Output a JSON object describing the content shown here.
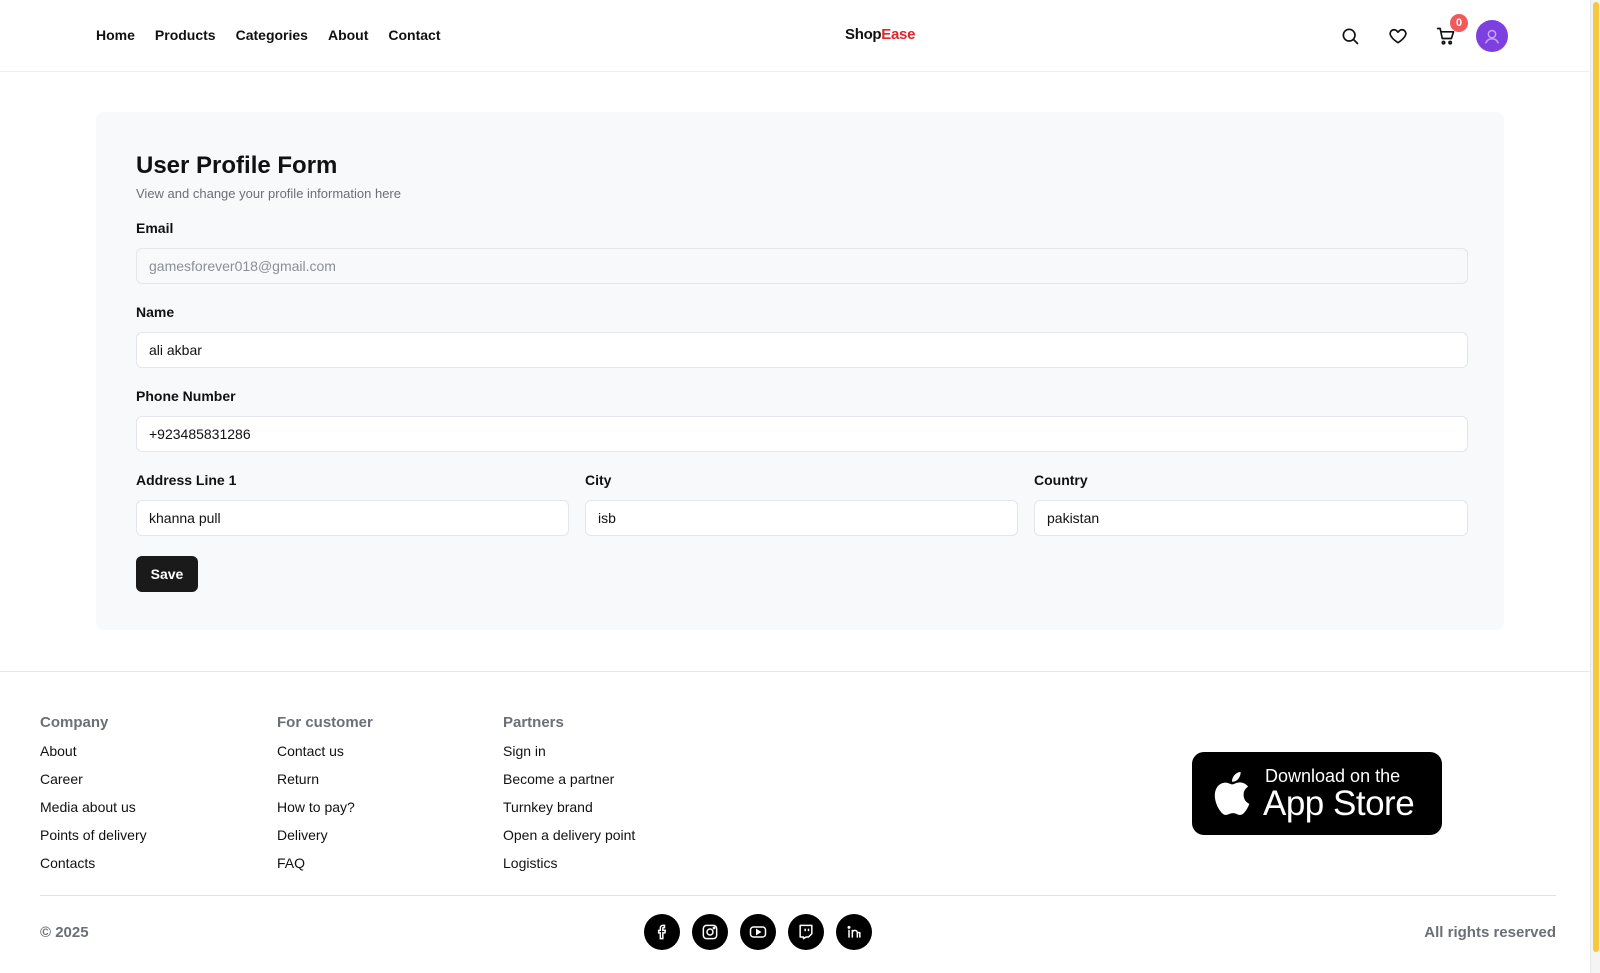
{
  "header": {
    "nav": [
      "Home",
      "Products",
      "Categories",
      "About",
      "Contact"
    ],
    "brand_part1": "Shop",
    "brand_part2": "Ease",
    "brand_accent": "#e0252b",
    "cart_count": "0",
    "icons": [
      "search-icon",
      "heart-icon",
      "cart-icon",
      "avatar"
    ]
  },
  "form": {
    "title": "User Profile Form",
    "subtitle": "View and change your profile information here",
    "email_label": "Email",
    "email_value": "gamesforever018@gmail.com",
    "name_label": "Name",
    "name_value": "ali akbar",
    "phone_label": "Phone Number",
    "phone_value": "+923485831286",
    "address_label": "Address Line 1",
    "address_value": "khanna pull",
    "city_label": "City",
    "city_value": "isb",
    "country_label": "Country",
    "country_value": "pakistan",
    "save_label": "Save"
  },
  "footer": {
    "columns": [
      {
        "title": "Company",
        "links": [
          "About",
          "Career",
          "Media about us",
          "Points of delivery",
          "Contacts"
        ]
      },
      {
        "title": "For customer",
        "links": [
          "Contact us",
          "Return",
          "How to pay?",
          "Delivery",
          "FAQ"
        ]
      },
      {
        "title": "Partners",
        "links": [
          "Sign in",
          "Become a partner",
          "Turnkey brand",
          "Open a delivery point",
          "Logistics"
        ]
      }
    ],
    "appstore_line1": "Download on the",
    "appstore_line2": "App Store",
    "copyright": "© 2025",
    "rights": "All rights reserved",
    "socials": [
      "facebook-icon",
      "instagram-icon",
      "youtube-icon",
      "twitch-icon",
      "linkedin-icon"
    ]
  }
}
